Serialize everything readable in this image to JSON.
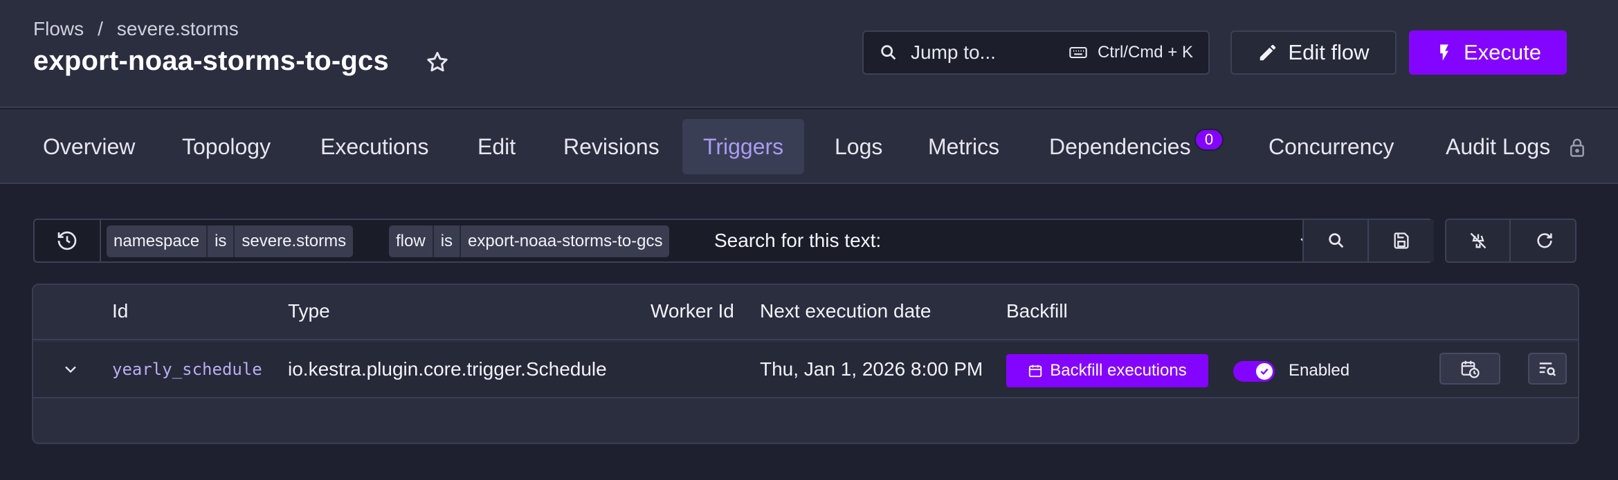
{
  "breadcrumb": {
    "root": "Flows",
    "separator": "/",
    "current": "severe.storms"
  },
  "page_title": "export-noaa-storms-to-gcs",
  "jump": {
    "label": "Jump to...",
    "shortcut": "Ctrl/Cmd + K"
  },
  "buttons": {
    "edit_flow": "Edit flow",
    "execute": "Execute"
  },
  "tabs": [
    {
      "label": "Overview"
    },
    {
      "label": "Topology"
    },
    {
      "label": "Executions"
    },
    {
      "label": "Edit"
    },
    {
      "label": "Revisions"
    },
    {
      "label": "Triggers"
    },
    {
      "label": "Logs"
    },
    {
      "label": "Metrics"
    },
    {
      "label": "Dependencies"
    },
    {
      "label": "Concurrency"
    },
    {
      "label": "Audit Logs"
    }
  ],
  "active_tab": "Triggers",
  "dependencies_badge": "0",
  "filters": [
    {
      "field": "namespace",
      "op": "is",
      "value": "severe.storms"
    },
    {
      "field": "flow",
      "op": "is",
      "value": "export-noaa-storms-to-gcs"
    }
  ],
  "search_placeholder": "Search for this text:",
  "table": {
    "headers": {
      "id": "Id",
      "type": "Type",
      "worker": "Worker Id",
      "next": "Next execution date",
      "backfill": "Backfill"
    },
    "row": {
      "id": "yearly_schedule",
      "type": "io.kestra.plugin.core.trigger.Schedule",
      "worker": "",
      "next": "Thu, Jan 1, 2026 8:00 PM",
      "backfill_button": "Backfill executions",
      "enabled_label": "Enabled",
      "enabled": true
    }
  },
  "colors": {
    "accent": "#8405ff",
    "active_tab_text": "#a99bf5",
    "background": "#1e2030",
    "panel": "#2b2e3f"
  }
}
